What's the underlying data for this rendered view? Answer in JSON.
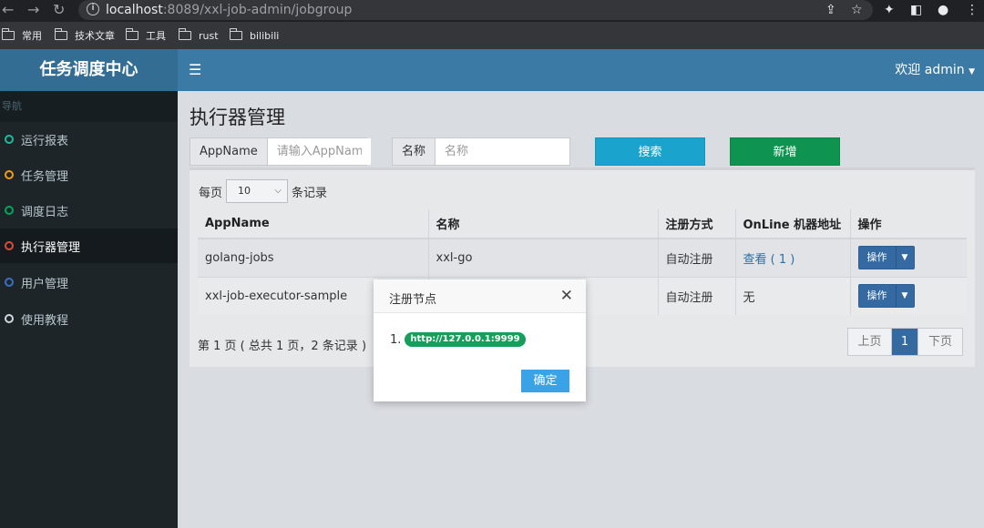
{
  "browser": {
    "url_host": "localhost",
    "url_rest": ":8089/xxl-job-admin/jobgroup",
    "bookmarks": [
      "常用",
      "技术文章",
      "工具",
      "rust",
      "bilibili"
    ]
  },
  "header": {
    "logo": "任务调度中心",
    "welcome": "欢迎 admin"
  },
  "sidebar": {
    "header": "导航",
    "items": [
      {
        "label": "运行报表",
        "color": "#1abc9c"
      },
      {
        "label": "任务管理",
        "color": "#f39c12"
      },
      {
        "label": "调度日志",
        "color": "#00a65a"
      },
      {
        "label": "执行器管理",
        "color": "#dd4b39"
      },
      {
        "label": "用户管理",
        "color": "#3c6fbf"
      },
      {
        "label": "使用教程",
        "color": "#d2d6de"
      }
    ]
  },
  "main": {
    "title": "执行器管理",
    "filter": {
      "appname_label": "AppName",
      "appname_placeholder": "请输入AppName",
      "name_label": "名称",
      "name_placeholder": "名称",
      "search_label": "搜索",
      "add_label": "新增"
    },
    "per_page_prefix": "每页",
    "per_page_value": "10",
    "per_page_suffix": "条记录",
    "table": {
      "headers": [
        "AppName",
        "名称",
        "注册方式",
        "OnLine 机器地址",
        "操作"
      ],
      "rows": [
        {
          "appname": "golang-jobs",
          "name": "xxl-go",
          "reg": "自动注册",
          "online": "查看 ( 1 )",
          "op": "操作"
        },
        {
          "appname": "xxl-job-executor-sample",
          "name": "",
          "reg": "自动注册",
          "online": "无",
          "op": "操作"
        }
      ]
    },
    "footer_info": "第 1 页 ( 总共 1 页，2 条记录 )",
    "pagination": {
      "prev": "上页",
      "current": "1",
      "next": "下页"
    }
  },
  "modal": {
    "title": "注册节点",
    "item_index": "1.",
    "item_address": "http://127.0.0.1:9999",
    "ok_label": "确定"
  }
}
